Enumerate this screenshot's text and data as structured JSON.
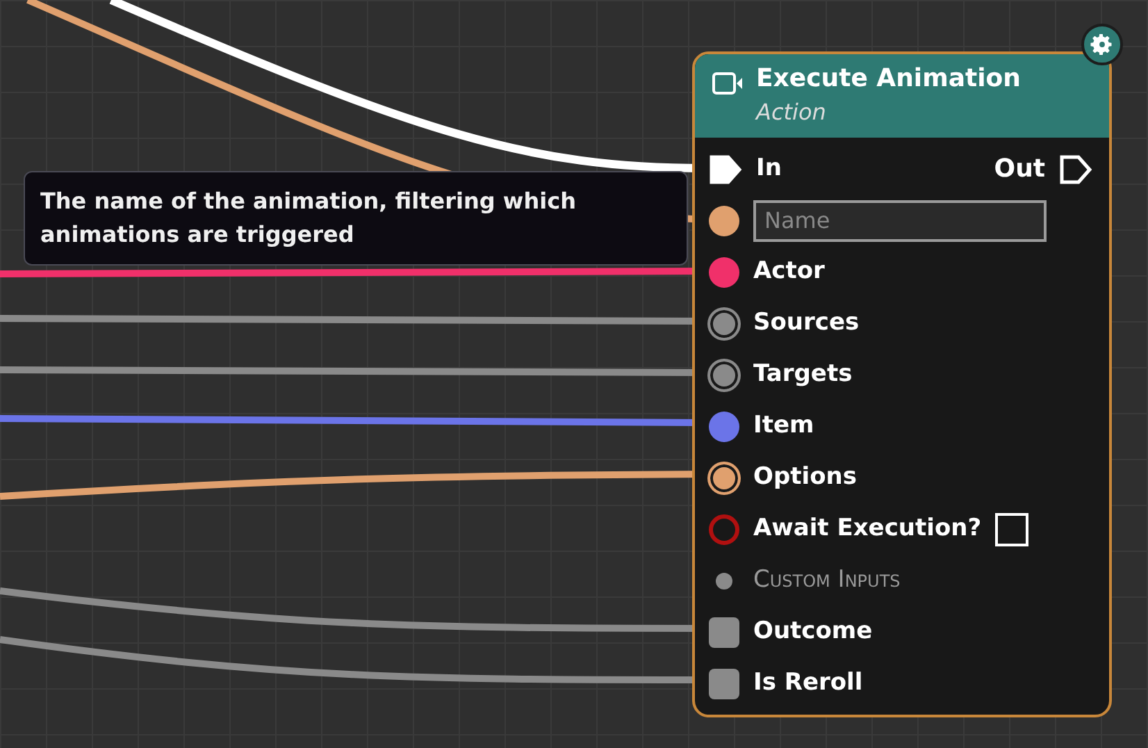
{
  "node": {
    "title": "Execute Animation",
    "subtitle": "Action",
    "output": {
      "label": "Out",
      "connected": false
    },
    "inputs": [
      {
        "kind": "exec",
        "label": "In",
        "connected": true,
        "color": "#ffffff"
      },
      {
        "kind": "field",
        "placeholder": "Name",
        "color": "#e0a06e"
      },
      {
        "kind": "data",
        "label": "Actor",
        "color": "#f0306a",
        "outlined": false
      },
      {
        "kind": "data",
        "label": "Sources",
        "color": "#8a8a8a",
        "outlined": true
      },
      {
        "kind": "data",
        "label": "Targets",
        "color": "#8a8a8a",
        "outlined": true
      },
      {
        "kind": "data",
        "label": "Item",
        "color": "#6b74e8",
        "outlined": false
      },
      {
        "kind": "data",
        "label": "Options",
        "color": "#e0a06e",
        "outlined": true
      },
      {
        "kind": "ring",
        "label": "Await Execution?",
        "color": "#b01010",
        "checked": false
      },
      {
        "kind": "section",
        "label": "Custom Inputs",
        "color": "#8a8a8a"
      },
      {
        "kind": "square",
        "label": "Outcome",
        "color": "#8a8a8a"
      },
      {
        "kind": "square",
        "label": "Is Reroll",
        "color": "#8a8a8a"
      }
    ]
  },
  "tooltip": {
    "text": "The name of the animation, filtering which animations are triggered"
  }
}
